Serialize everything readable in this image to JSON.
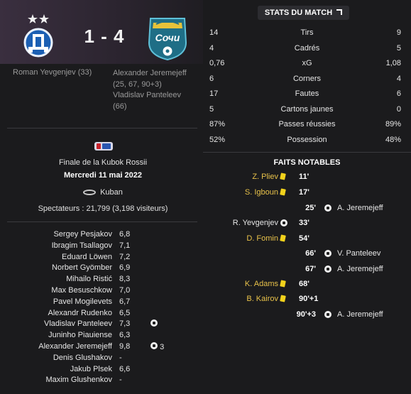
{
  "match": {
    "score": "1 - 4",
    "home_scorers": "Roman Yevgenjev (33)",
    "away_scorers": [
      "Alexander Jeremejeff",
      "(25, 67, 90+3)",
      "Vladislav Panteleev",
      "(66)"
    ],
    "home_logo_icon": "dynamo-moscow-crest",
    "away_logo_icon": "sochi-crest"
  },
  "info": {
    "competition": "Finale de la Kubok Rossii",
    "date": "Mercredi 11 mai 2022",
    "stadium": "Kuban",
    "attendance": "Spectateurs : 21,799 (3,198 visiteurs)"
  },
  "players": [
    {
      "name": "Sergey Pesjakov",
      "rating": "6,8",
      "event": ""
    },
    {
      "name": "Ibragim Tsallagov",
      "rating": "7,1",
      "event": ""
    },
    {
      "name": "Eduard Löwen",
      "rating": "7,2",
      "event": ""
    },
    {
      "name": "Norbert Gyömber",
      "rating": "6,9",
      "event": ""
    },
    {
      "name": "Mihailo Ristić",
      "rating": "8,3",
      "event": ""
    },
    {
      "name": "Max Besuschkow",
      "rating": "7,0",
      "event": ""
    },
    {
      "name": "Pavel Mogilevets",
      "rating": "6,7",
      "event": ""
    },
    {
      "name": "Alexandr Rudenko",
      "rating": "6,5",
      "event": ""
    },
    {
      "name": "Vladislav Panteleev",
      "rating": "7,3",
      "event": "goal"
    },
    {
      "name": "Juninho Piauiense",
      "rating": "6,3",
      "event": ""
    },
    {
      "name": "Alexander Jeremejeff",
      "rating": "9,8",
      "event": "goal",
      "event_count": "3"
    },
    {
      "name": "Denis Glushakov",
      "rating": "-",
      "event": ""
    },
    {
      "name": "Jakub Plsek",
      "rating": "6,6",
      "event": ""
    },
    {
      "name": "Maxim Glushenkov",
      "rating": "-",
      "event": ""
    }
  ],
  "stats": {
    "title": "STATS DU MATCH",
    "rows": [
      {
        "home": "14",
        "label": "Tirs",
        "away": "9"
      },
      {
        "home": "4",
        "label": "Cadrés",
        "away": "5"
      },
      {
        "home": "0,76",
        "label": "xG",
        "away": "1,08"
      },
      {
        "home": "6",
        "label": "Corners",
        "away": "4"
      },
      {
        "home": "17",
        "label": "Fautes",
        "away": "6"
      },
      {
        "home": "5",
        "label": "Cartons jaunes",
        "away": "0"
      },
      {
        "home": "87%",
        "label": "Passes réussies",
        "away": "89%"
      },
      {
        "home": "52%",
        "label": "Possession",
        "away": "48%"
      }
    ]
  },
  "facts": {
    "title": "FAITS NOTABLES",
    "events": [
      {
        "home": "Z. Pliev",
        "home_icon": "card",
        "time": "11'",
        "away": "",
        "away_icon": ""
      },
      {
        "home": "S. Igboun",
        "home_icon": "card",
        "time": "17'",
        "away": "",
        "away_icon": ""
      },
      {
        "home": "",
        "home_icon": "",
        "time": "25'",
        "away": "A. Jeremejeff",
        "away_icon": "goal"
      },
      {
        "home": "R. Yevgenjev",
        "home_icon": "goal",
        "time": "33'",
        "away": "",
        "away_icon": ""
      },
      {
        "home": "D. Fomin",
        "home_icon": "card",
        "time": "54'",
        "away": "",
        "away_icon": ""
      },
      {
        "home": "",
        "home_icon": "",
        "time": "66'",
        "away": "V. Panteleev",
        "away_icon": "goal"
      },
      {
        "home": "",
        "home_icon": "",
        "time": "67'",
        "away": "A. Jeremejeff",
        "away_icon": "goal"
      },
      {
        "home": "K. Adams",
        "home_icon": "card",
        "time": "68'",
        "away": "",
        "away_icon": ""
      },
      {
        "home": "B. Kairov",
        "home_icon": "card",
        "time": "90'+1",
        "away": "",
        "away_icon": ""
      },
      {
        "home": "",
        "home_icon": "",
        "time": "90'+3",
        "away": "A. Jeremejeff",
        "away_icon": "goal"
      }
    ]
  }
}
